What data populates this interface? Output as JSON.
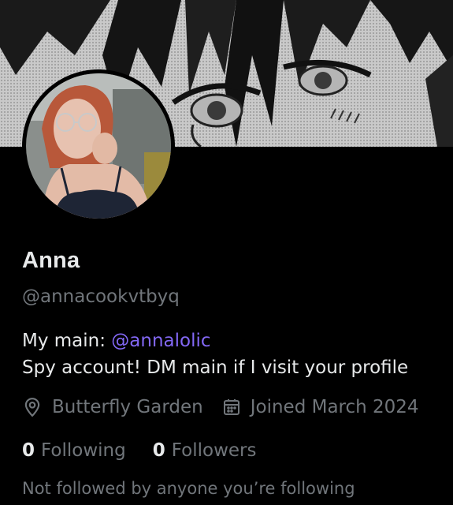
{
  "profile": {
    "display_name": "Anna",
    "handle": "@annacookvtbyq",
    "bio": {
      "line1_prefix": "My main: ",
      "line1_mention": "@annalolic",
      "line2": "Spy account! DM main if I visit your profile"
    },
    "location": "Butterfly Garden",
    "joined": "Joined March 2024",
    "following_count": "0",
    "following_label": "Following",
    "followers_count": "0",
    "followers_label": "Followers",
    "mutuals_note": "Not followed by anyone you’re following"
  },
  "icons": {
    "location": "location-pin-icon",
    "joined": "calendar-icon"
  },
  "colors": {
    "background": "#000000",
    "primary_text": "#e7e9ea",
    "secondary_text": "#71767b",
    "mention": "#8368f5"
  }
}
